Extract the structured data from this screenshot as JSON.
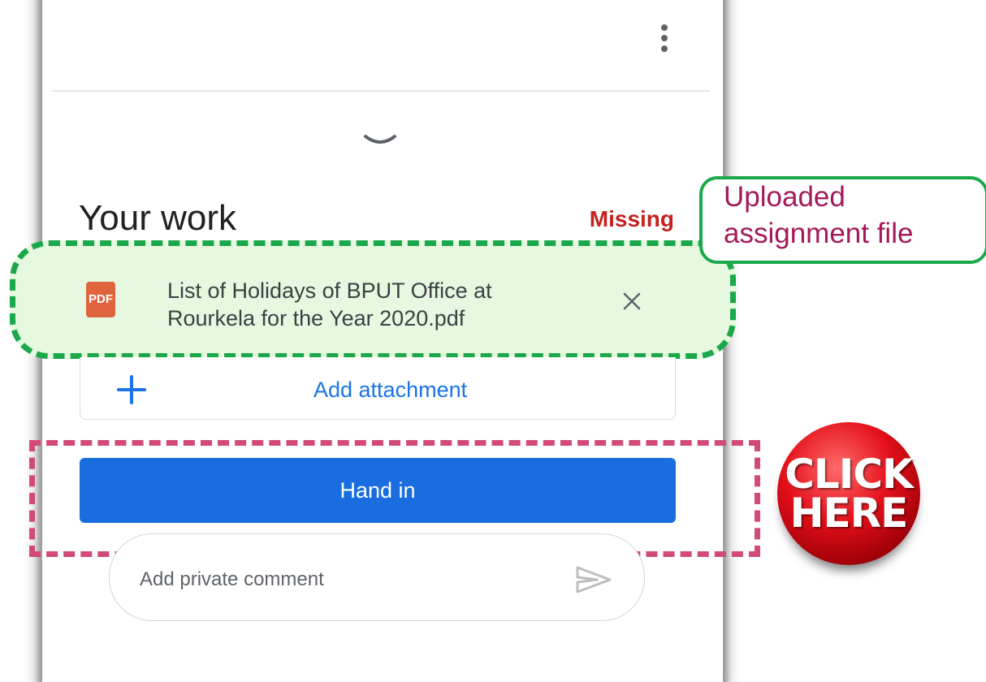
{
  "header": {
    "menu_icon": "more-vert-icon"
  },
  "collapse_icon": "chevron-down-icon",
  "your_work": {
    "title": "Your work",
    "status": "Missing",
    "status_color": "#c5221f"
  },
  "attachment": {
    "badge": "PDF",
    "file_name_line1": "List of Holidays of BPUT Office at",
    "file_name_line2": "Rourkela for the Year 2020.pdf",
    "remove_icon": "close-icon",
    "badge_color": "#e0653f"
  },
  "add_attachment": {
    "label": "Add attachment",
    "icon": "plus-icon"
  },
  "hand_in": {
    "label": "Hand in",
    "color": "#1a6ddf"
  },
  "private_comment": {
    "placeholder": "Add private comment",
    "send_icon": "send-icon"
  },
  "annotation": {
    "callout_line1": "Uploaded",
    "callout_line2": "assignment file",
    "click_line1": "CLICK",
    "click_line2": "HERE"
  }
}
